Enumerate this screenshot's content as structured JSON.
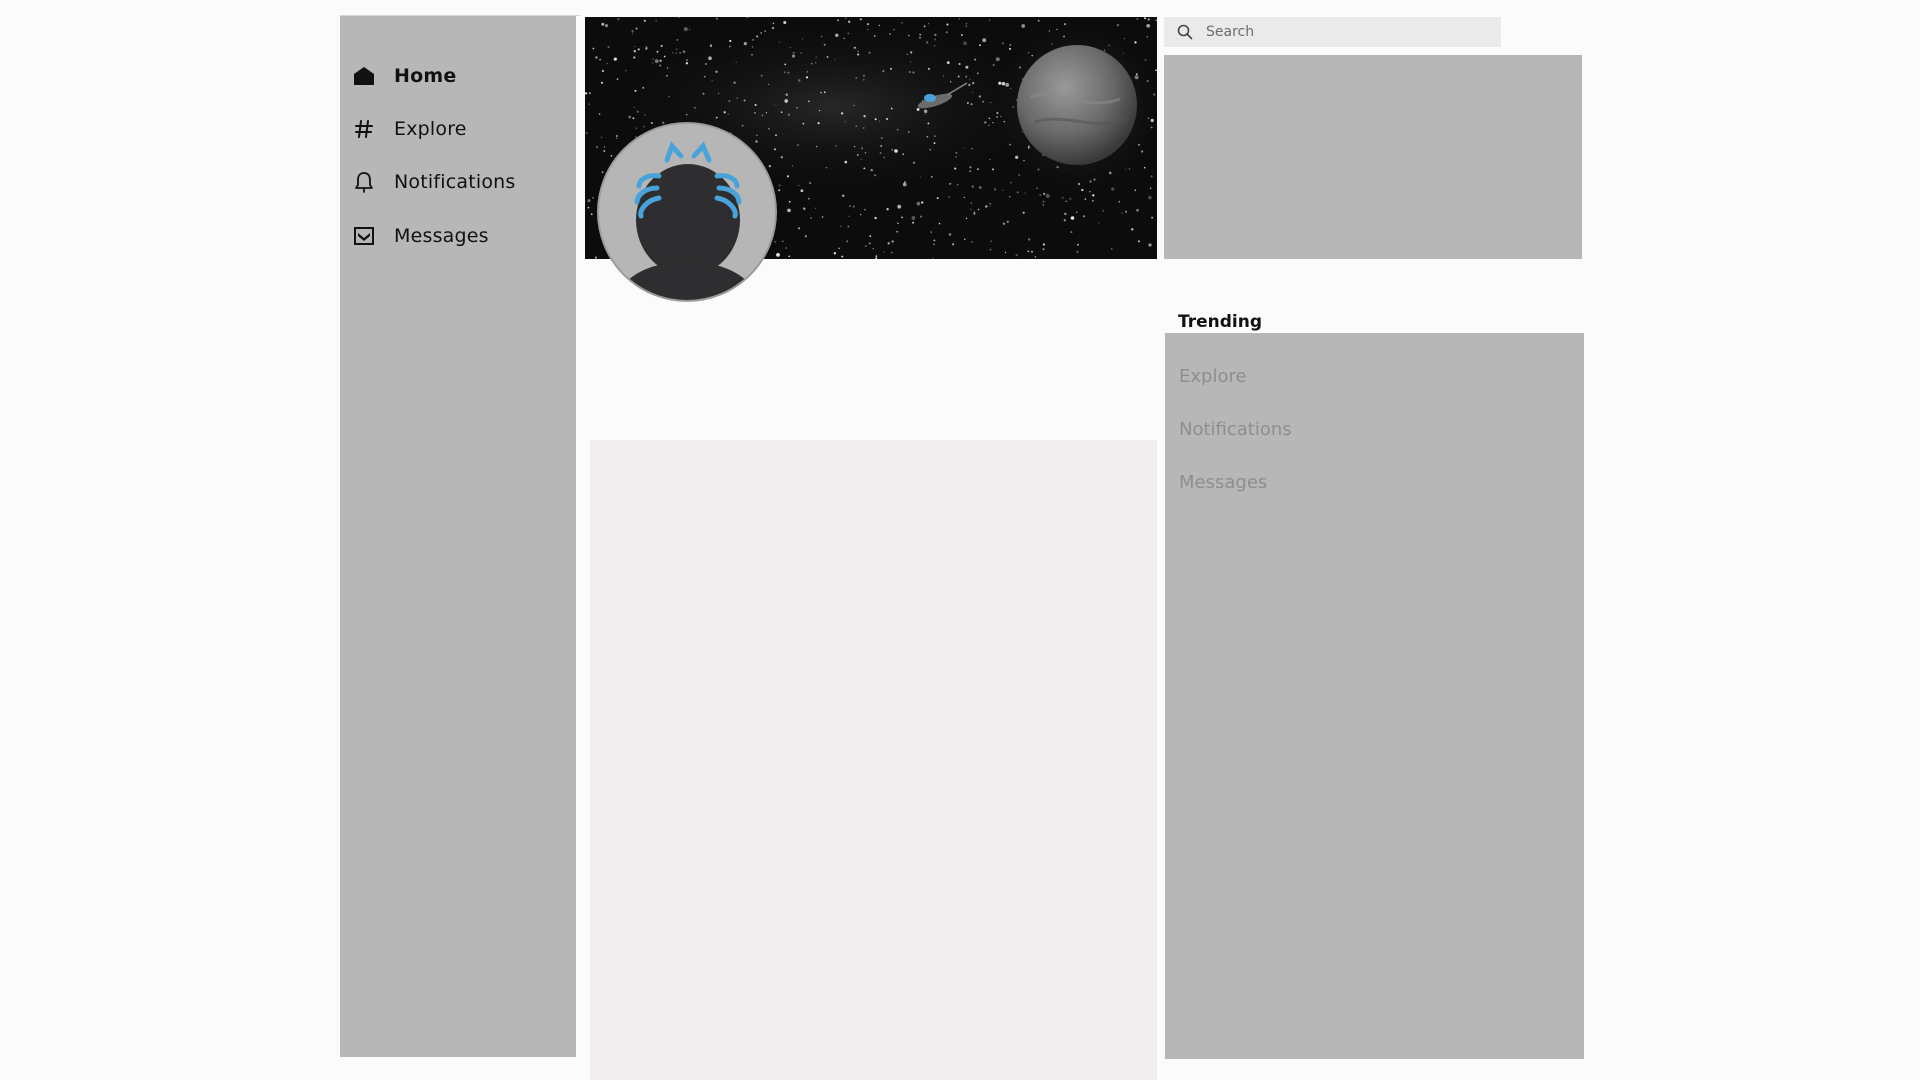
{
  "sidebar": {
    "items": [
      {
        "label": "Home",
        "icon": "home-icon"
      },
      {
        "label": "Explore",
        "icon": "hashtag-icon"
      },
      {
        "label": "Notifications",
        "icon": "bell-icon"
      },
      {
        "label": "Messages",
        "icon": "inbox-icon"
      }
    ]
  },
  "search": {
    "placeholder": "Search",
    "icon": "search-icon"
  },
  "trending": {
    "title": "Trending",
    "items": [
      {
        "label": "Explore"
      },
      {
        "label": "Notifications"
      },
      {
        "label": "Messages"
      }
    ]
  },
  "colors": {
    "panel": "#b8b7b8",
    "feed": "#f0eeef",
    "accent_ears": "#4aa3d8"
  }
}
